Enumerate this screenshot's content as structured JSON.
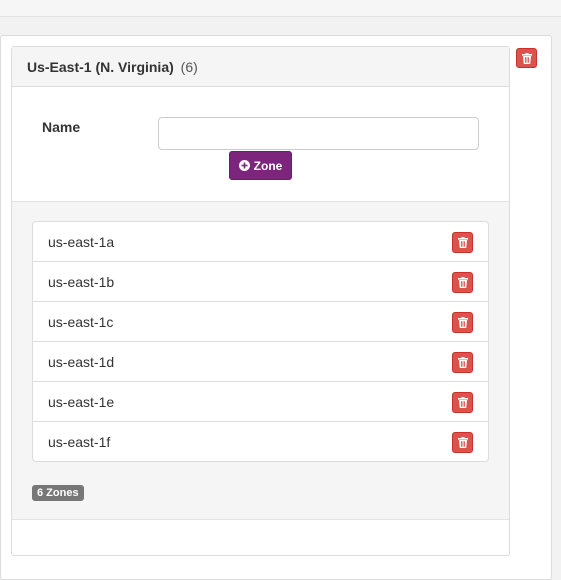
{
  "region": {
    "name": "Us-East-1 (N. Virginia)",
    "count_label": "(6)"
  },
  "form": {
    "name_label": "Name",
    "name_value": "",
    "name_placeholder": "",
    "add_zone_label": "Zone"
  },
  "zones": [
    {
      "name": "us-east-1a"
    },
    {
      "name": "us-east-1b"
    },
    {
      "name": "us-east-1c"
    },
    {
      "name": "us-east-1d"
    },
    {
      "name": "us-east-1e"
    },
    {
      "name": "us-east-1f"
    }
  ],
  "zones_badge": "6 Zones",
  "icons": {
    "delete": "trash-icon",
    "add": "plus-circle-icon"
  },
  "colors": {
    "danger": "#d9534f",
    "primary_purple": "#7d257d",
    "badge": "#777777"
  }
}
